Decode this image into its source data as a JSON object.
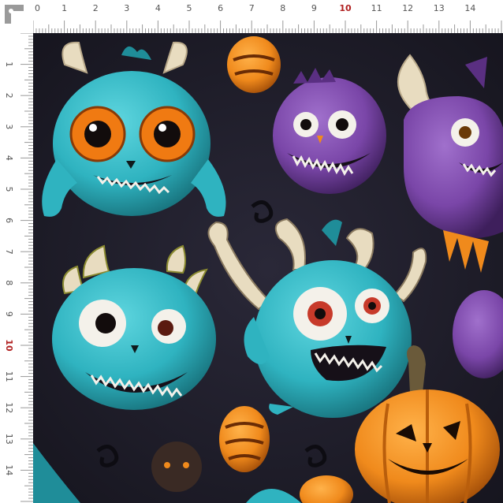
{
  "ruler": {
    "numbers": [
      "0",
      "1",
      "2",
      "3",
      "4",
      "5",
      "6",
      "7",
      "8",
      "9",
      "10",
      "11",
      "12",
      "13",
      "14"
    ],
    "highlight": "10",
    "tick_color": "#999999",
    "label_color": "#555555",
    "highlight_color": "#b02020"
  },
  "palette": {
    "background": "#1b1a26",
    "teal": "#2fb3c0",
    "teal_dark": "#1f8d99",
    "purple": "#7a46a8",
    "purple_dark": "#5a2f82",
    "orange": "#f08a1c",
    "orange_dark": "#c7650e",
    "horn": "#e8dcc0",
    "eye_white": "#f4f1ea",
    "iris_orange": "#f07a12",
    "iris_red": "#c73a2a",
    "mouth": "#161018"
  },
  "icons": [
    "monster-icon",
    "pumpkin-icon",
    "candy-icon"
  ]
}
